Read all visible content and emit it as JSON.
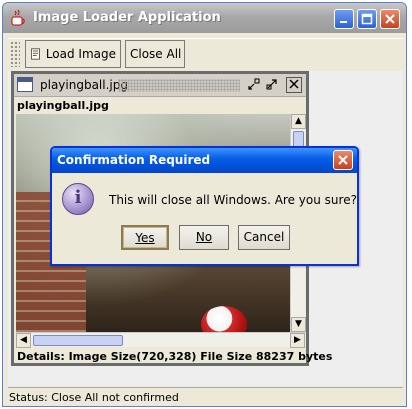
{
  "app": {
    "title": "Image Loader Application"
  },
  "toolbar": {
    "load_image_label": "Load Image",
    "close_all_label": "Close All"
  },
  "internal_frame": {
    "title": "playingball.jpg",
    "image_label": "playingball.jpg",
    "details": "Details: Image Size(720,328) File Size 88237 bytes"
  },
  "dialog": {
    "title": "Confirmation Required",
    "message": "This will close all Windows. Are you sure?",
    "yes_label": "Yes",
    "no_label": "No",
    "cancel_label": "Cancel"
  },
  "status": {
    "text": "Status: Close All not confirmed"
  },
  "colors": {
    "dialog_title_blue": "#0a5fe8",
    "app_title_gray": "#a8a8a8",
    "window_bg": "#ece9d8",
    "close_red": "#c8411d"
  }
}
